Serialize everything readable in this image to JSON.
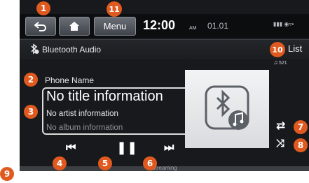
{
  "header": {
    "menu_label": "Menu",
    "clock": "12:00",
    "ampm": "AM",
    "date": "01.01"
  },
  "source": {
    "label": "Bluetooth Audio",
    "list_label": "List",
    "track_count": "521"
  },
  "now_playing": {
    "phone_name": "Phone Name",
    "title": "No title information",
    "artist": "No artist information",
    "album": "No album information"
  },
  "progress": {
    "label": "Streaming"
  },
  "callouts": [
    "1",
    "2",
    "3",
    "4",
    "5",
    "6",
    "7",
    "8",
    "9",
    "10",
    "11"
  ],
  "icons": {
    "back": "back-arrow-icon",
    "home": "home-icon",
    "source": "bluetooth-audio-icon",
    "prev": "previous-track-icon",
    "pause": "pause-icon",
    "next": "next-track-icon",
    "repeat": "repeat-icon",
    "shuffle": "shuffle-icon",
    "album_art": "bluetooth-music-icon"
  },
  "colors": {
    "callout": "#e05a20",
    "screen_bg": "#17191c"
  }
}
